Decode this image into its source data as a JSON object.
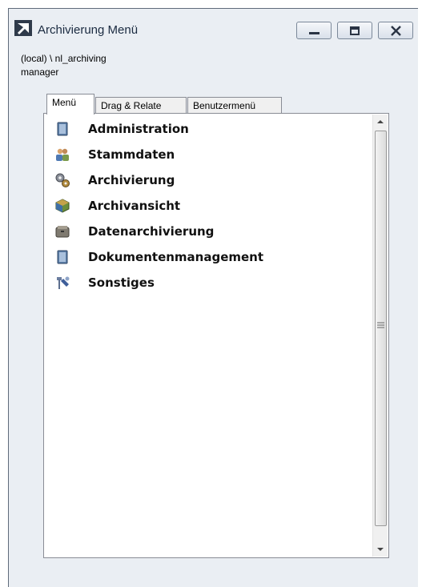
{
  "window": {
    "title": "Archivierung Menü",
    "controls": [
      "minimize-icon",
      "restore-icon",
      "close-icon"
    ]
  },
  "connection": {
    "line1": "(local) \\ nl_archiving",
    "line2": "manager"
  },
  "tabs": [
    {
      "label": "Menü",
      "active": true
    },
    {
      "label": "Drag & Relate",
      "active": false
    },
    {
      "label": "Benutzermenü",
      "active": false
    }
  ],
  "menu": {
    "items": [
      {
        "label": "Administration",
        "icon": "book-icon"
      },
      {
        "label": "Stammdaten",
        "icon": "users-icon"
      },
      {
        "label": "Archivierung",
        "icon": "gears-icon"
      },
      {
        "label": "Archivansicht",
        "icon": "cube-icon"
      },
      {
        "label": "Datenarchivierung",
        "icon": "archive-box-icon"
      },
      {
        "label": "Dokumentenmanagement",
        "icon": "book-icon"
      },
      {
        "label": "Sonstiges",
        "icon": "tools-icon"
      }
    ]
  }
}
